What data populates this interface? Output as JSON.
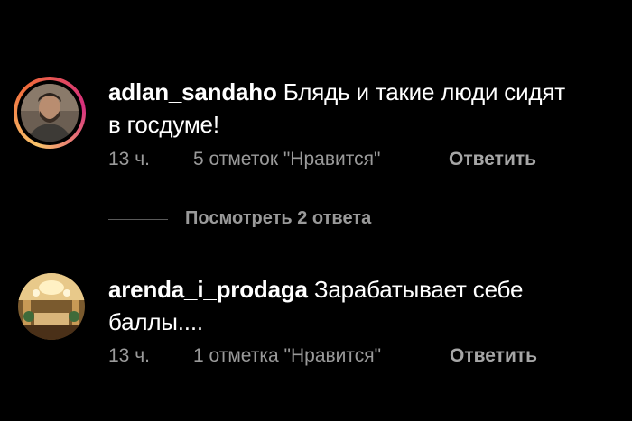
{
  "comments": [
    {
      "username": "adlan_sandaho",
      "text": "Блядь и такие люди сидят в госдуме!",
      "time": "13 ч.",
      "likes": "5 отметок \"Нравится\"",
      "reply": "Ответить",
      "avatar_icon": "user-photo-icon",
      "has_story_ring": true
    },
    {
      "username": "arenda_i_prodaga",
      "text": "Зарабатывает себе баллы....",
      "time": "13 ч.",
      "likes": "1 отметка \"Нравится\"",
      "reply": "Ответить",
      "avatar_icon": "interior-photo-icon",
      "has_story_ring": false
    }
  ],
  "view_replies": "Посмотреть 2 ответа",
  "colors": {
    "background": "#000000",
    "text": "#ffffff",
    "meta": "#9a9a9a",
    "ring_start": "#f9c36a",
    "ring_end": "#d62f7e"
  }
}
